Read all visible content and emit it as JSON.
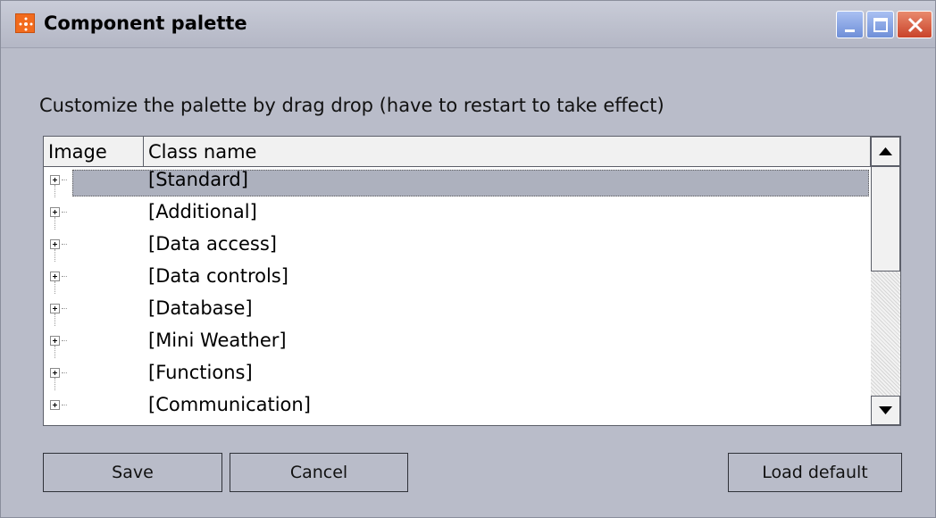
{
  "window": {
    "title": "Component palette",
    "icons": {
      "app": "app-icon",
      "minimize": "minimize-icon",
      "maximize": "maximize-icon",
      "close": "close-icon"
    }
  },
  "instructions": "Customize the palette by drag drop (have to restart to take effect)",
  "listview": {
    "columns": [
      "Image",
      "Class name"
    ],
    "rows": [
      {
        "label": "[Standard]",
        "selected": true
      },
      {
        "label": "[Additional]"
      },
      {
        "label": "[Data access]"
      },
      {
        "label": "[Data controls]"
      },
      {
        "label": "[Database]"
      },
      {
        "label": "[Mini Weather]"
      },
      {
        "label": "[Functions]"
      },
      {
        "label": "[Communication]"
      }
    ]
  },
  "buttons": {
    "save": "Save",
    "cancel": "Cancel",
    "load_default": "Load default"
  },
  "colors": {
    "window_bg": "#b9bcc9",
    "selection": "#adb1be",
    "close_button": "#c9432a",
    "app_icon": "#f26b1d"
  }
}
